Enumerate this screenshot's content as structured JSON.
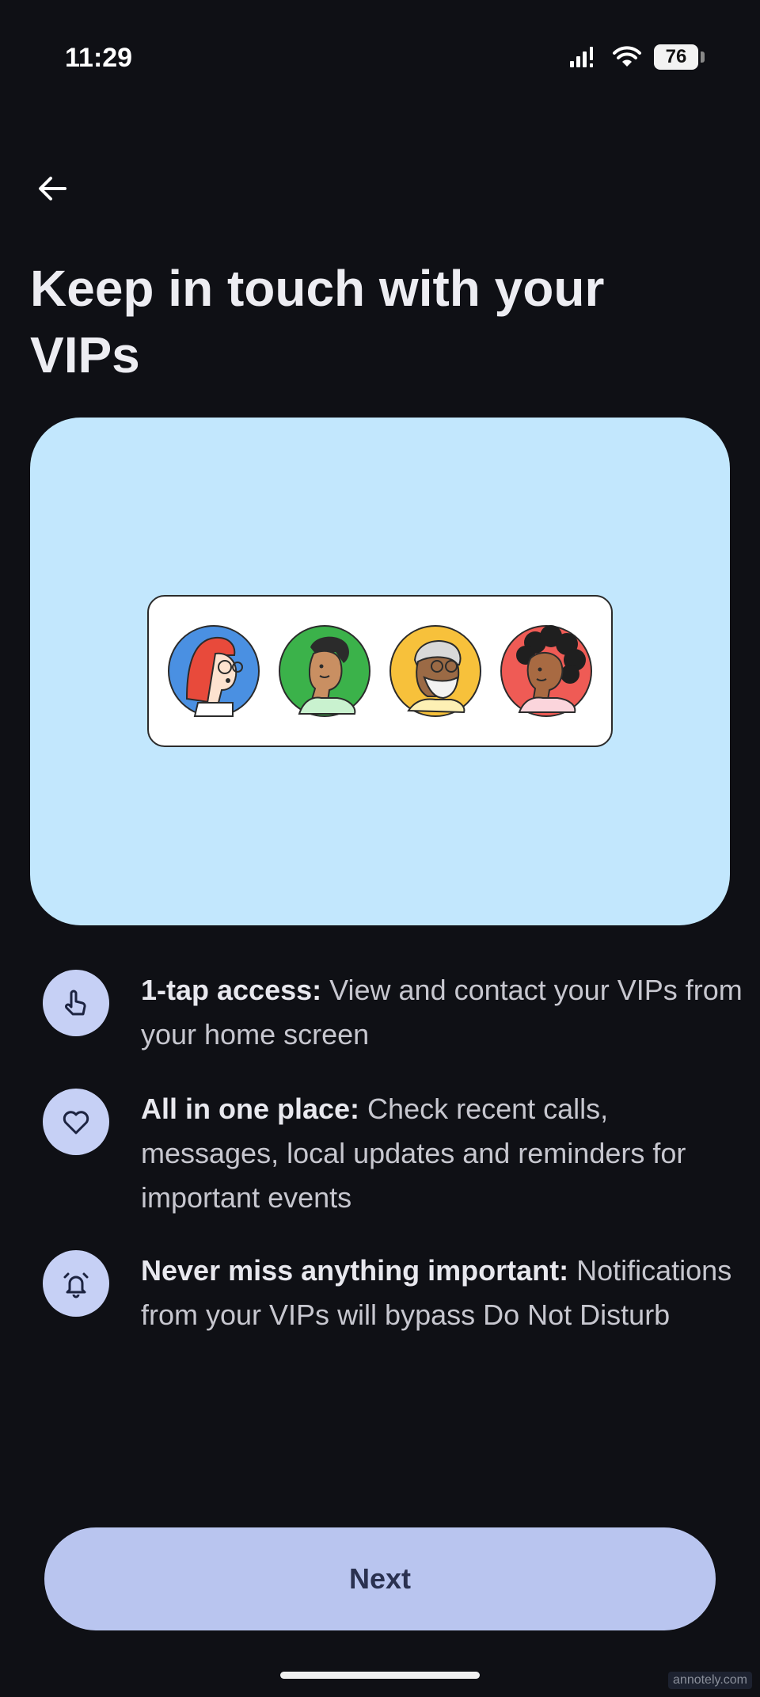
{
  "status_bar": {
    "time": "11:29",
    "battery_level": "76",
    "icons": [
      "signal-icon",
      "wifi-icon",
      "battery-icon"
    ]
  },
  "header": {
    "back_icon": "arrow-left-icon",
    "title": "Keep in touch with your VIPs"
  },
  "hero": {
    "background_color": "#c2e7fd",
    "avatars": [
      "red-hair-glasses-avatar",
      "green-shirt-avatar",
      "yellow-bearded-glasses-avatar",
      "red-curly-hair-avatar"
    ]
  },
  "features": [
    {
      "icon": "tap-hand-icon",
      "title": "1-tap access:",
      "description": " View and contact your VIPs from your home screen"
    },
    {
      "icon": "heart-icon",
      "title": "All in one place:",
      "description": " Check recent calls, messages, local updates and reminders for important events"
    },
    {
      "icon": "alarm-bell-icon",
      "title": "Never miss anything important:",
      "description": " Notifications from your VIPs will bypass Do Not Disturb"
    }
  ],
  "footer": {
    "next_label": "Next",
    "watermark": "annotely.com"
  },
  "colors": {
    "background": "#0f1015",
    "accent_button": "#b9c5ef",
    "icon_circle": "#c6d0f5"
  }
}
